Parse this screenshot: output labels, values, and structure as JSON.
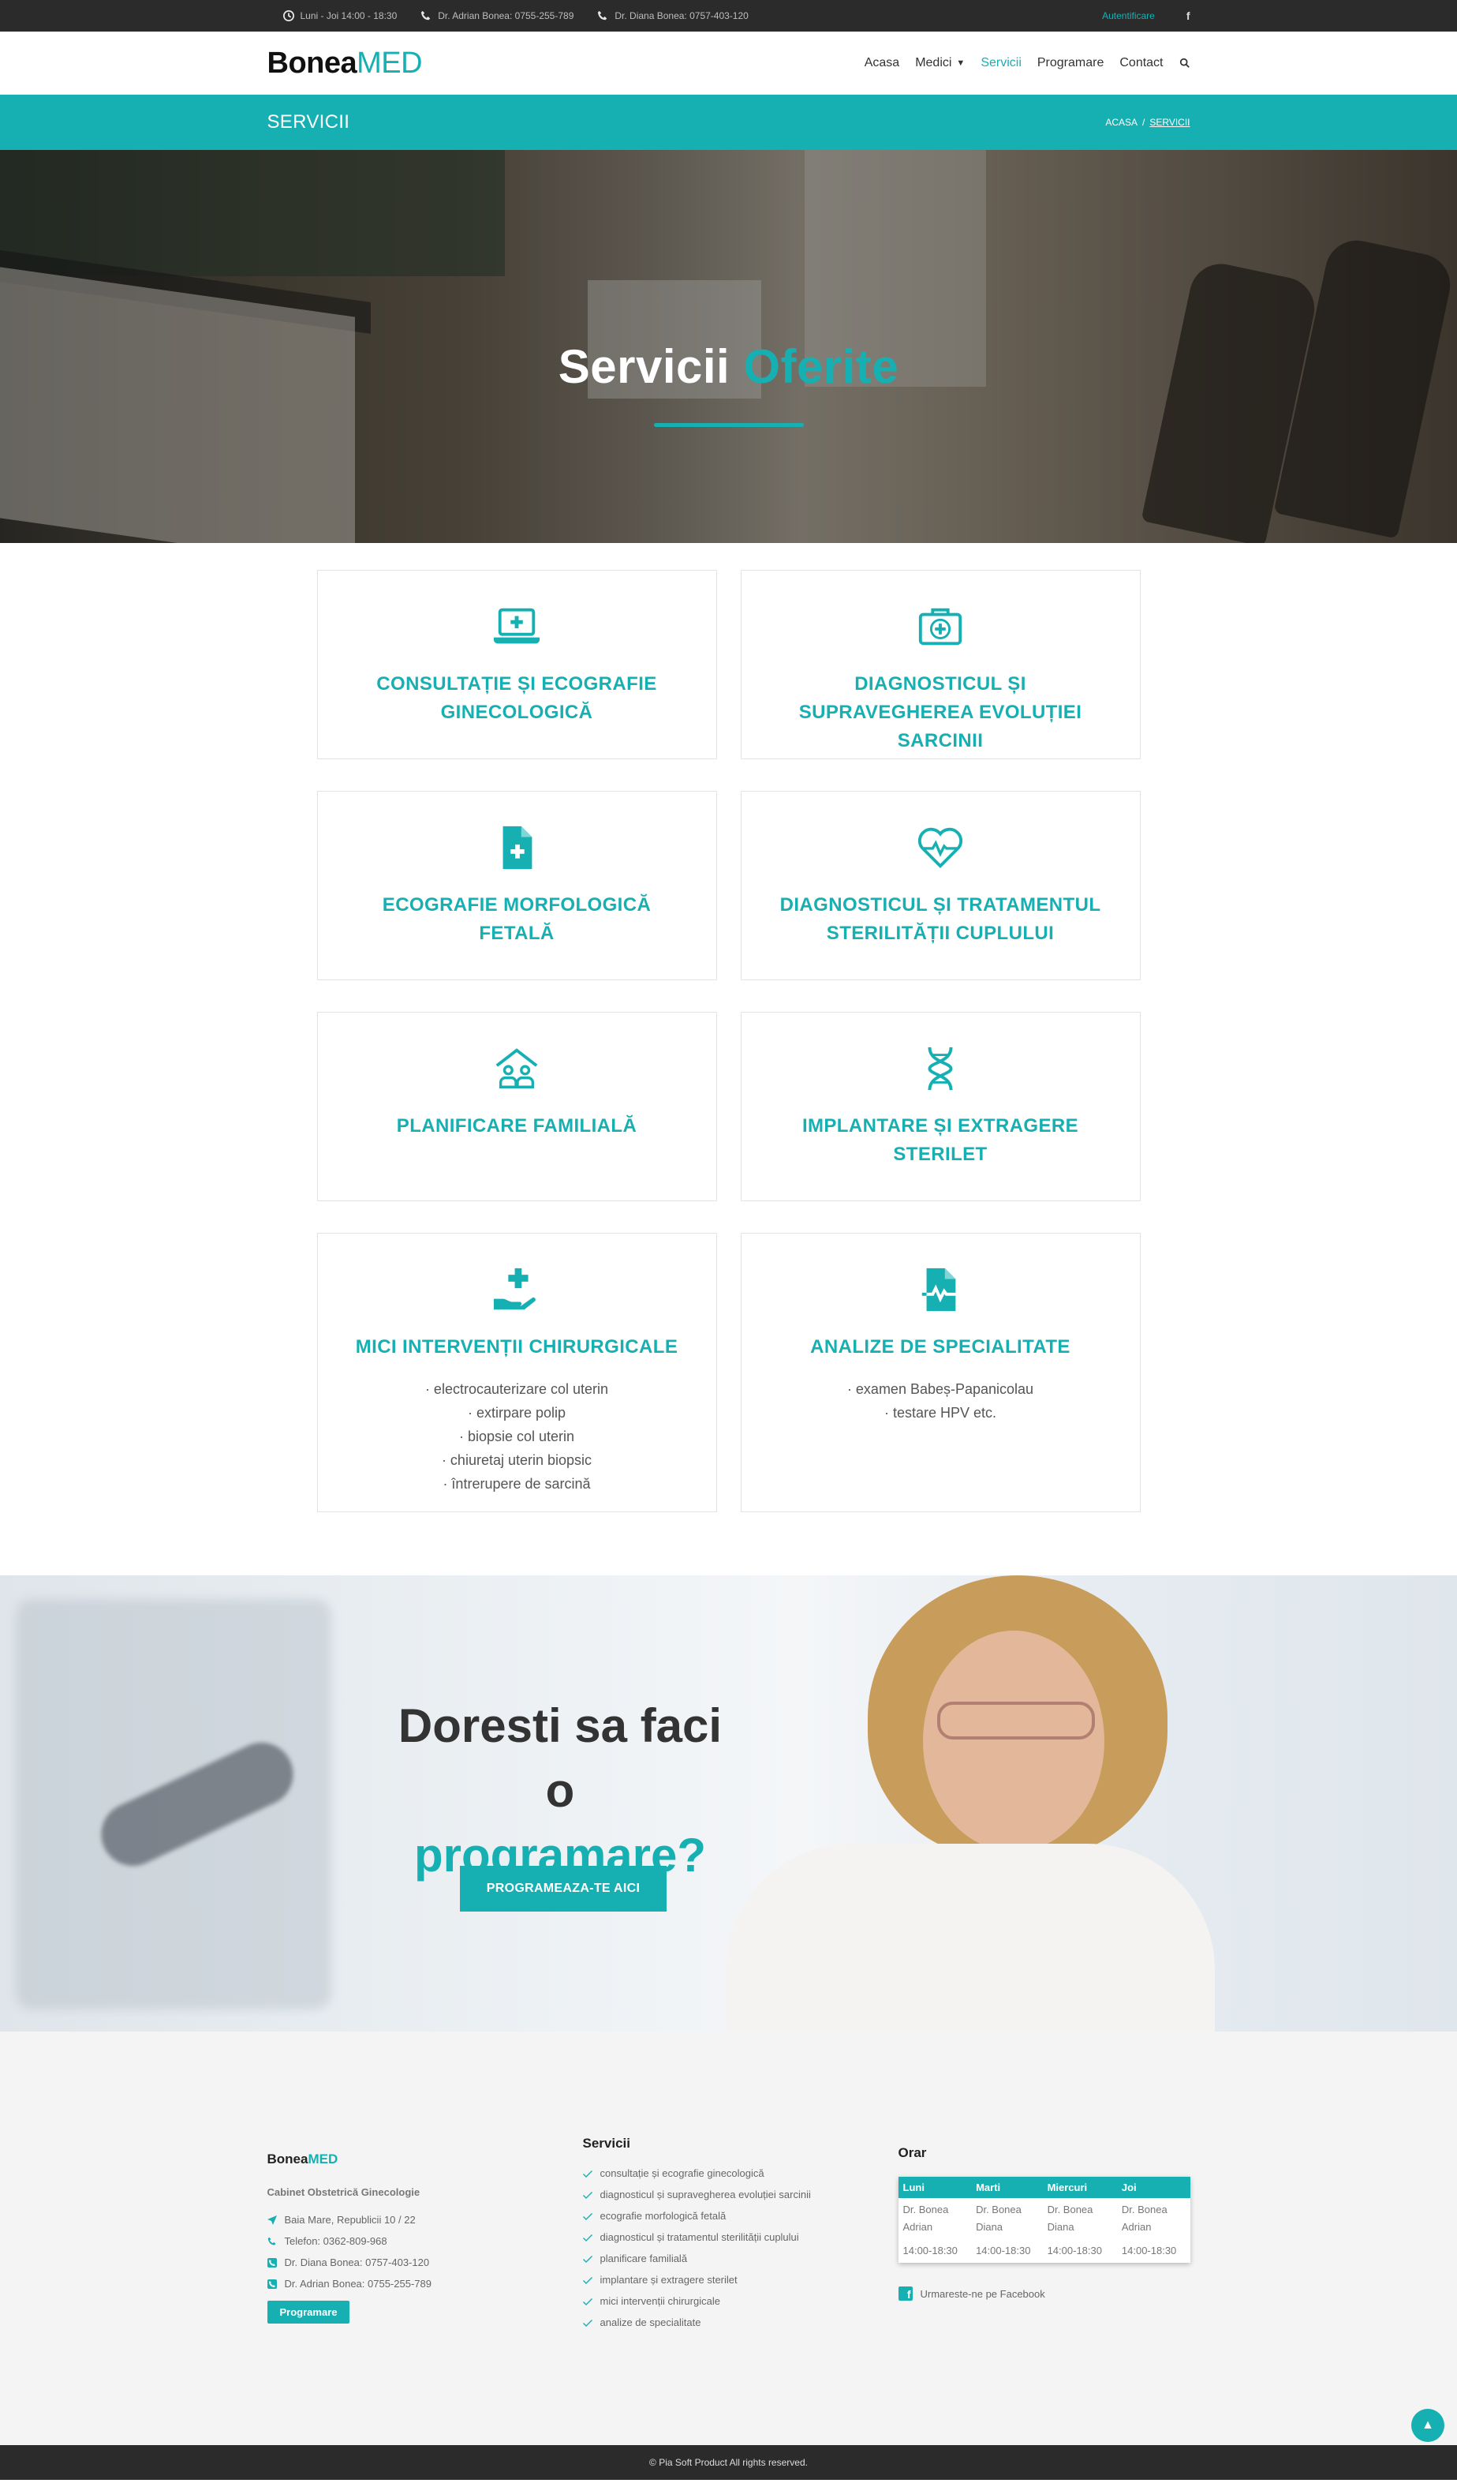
{
  "topbar": {
    "hours": "Luni - Joi 14:00 - 18:30",
    "phone1": "Dr. Adrian Bonea: 0755-255-789",
    "phone2": "Dr. Diana Bonea: 0757-403-120",
    "login": "Autentificare",
    "facebook": "f"
  },
  "header": {
    "logo_main": "Bonea",
    "logo_accent": "MED",
    "nav": [
      "Acasa",
      "Medici",
      "Servicii",
      "Programare",
      "Contact"
    ],
    "active": "Servicii"
  },
  "titlebar": {
    "title": "SERVICII",
    "crumb_home": "ACASA",
    "crumb_sep": "/",
    "crumb_current": "SERVICII"
  },
  "hero": {
    "title_main": "Servicii",
    "title_accent": "Oferite"
  },
  "services": [
    {
      "icon": "laptop-medical-icon",
      "title": "CONSULTAȚIE ȘI ECOGRAFIE GINECOLOGICĂ",
      "items": []
    },
    {
      "icon": "first-aid-kit-icon",
      "title": "DIAGNOSTICUL ȘI SUPRAVEGHEREA EVOLUȚIEI SARCINII",
      "items": []
    },
    {
      "icon": "file-medical-icon",
      "title": "ECOGRAFIE MORFOLOGICĂ FETALĂ",
      "items": []
    },
    {
      "icon": "heartbeat-icon",
      "title": "DIAGNOSTICUL ȘI TRATAMENTUL STERILITĂȚII CUPLULUI",
      "items": []
    },
    {
      "icon": "family-home-icon",
      "title": "PLANIFICARE FAMILIALĂ",
      "items": []
    },
    {
      "icon": "dna-icon",
      "title": "IMPLANTARE ȘI EXTRAGERE STERILET",
      "items": []
    },
    {
      "icon": "hand-holding-medical-icon",
      "title": "MICI INTERVENȚII CHIRURGICALE",
      "items": [
        "· electrocauterizare col uterin",
        "· extirpare polip",
        "· biopsie col uterin",
        "· chiuretaj uterin biopsic",
        "· întrerupere de sarcină"
      ]
    },
    {
      "icon": "file-waveform-icon",
      "title": "ANALIZE DE SPECIALITATE",
      "items": [
        "· examen Babeș-Papanicolau",
        "· testare HPV etc."
      ]
    }
  ],
  "cta": {
    "line1": "Doresti sa faci o",
    "line2": "programare?",
    "button": "PROGRAMEAZA-TE AICI"
  },
  "footer": {
    "logo_main": "Bonea",
    "logo_accent": "MED",
    "subtitle": "Cabinet Obstetrică Ginecologie",
    "info": [
      {
        "icon": "location-arrow-icon",
        "text": "Baia Mare, Republicii 10 / 22"
      },
      {
        "icon": "phone-icon",
        "text": "Telefon: 0362-809-968"
      },
      {
        "icon": "phone-square-icon",
        "text": "Dr. Diana Bonea: 0757-403-120"
      },
      {
        "icon": "phone-square-icon",
        "text": "Dr. Adrian Bonea: 0755-255-789"
      }
    ],
    "button": "Programare",
    "services_title": "Servicii",
    "services": [
      "consultație și ecografie ginecologică",
      "diagnosticul și supravegherea evoluției sarcinii",
      "ecografie morfologică fetală",
      "diagnosticul și tratamentul sterilității cuplului",
      "planificare familială",
      "implantare și extragere sterilet",
      "mici intervenții chirurgicale",
      "analize de specialitate"
    ],
    "schedule_title": "Orar",
    "schedule": {
      "days": [
        "Luni",
        "Marti",
        "Miercuri",
        "Joi"
      ],
      "doctors": [
        "Dr. Bonea Adrian",
        "Dr. Bonea Diana",
        "Dr. Bonea Diana",
        "Dr. Bonea Adrian"
      ],
      "hours": [
        "14:00-18:30",
        "14:00-18:30",
        "14:00-18:30",
        "14:00-18:30"
      ]
    },
    "facebook": "Urmareste-ne pe Facebook",
    "copyright": "© Pia Soft Product All rights reserved."
  },
  "colors": {
    "accent": "#16b0b3",
    "dark": "#2b2b2b"
  }
}
